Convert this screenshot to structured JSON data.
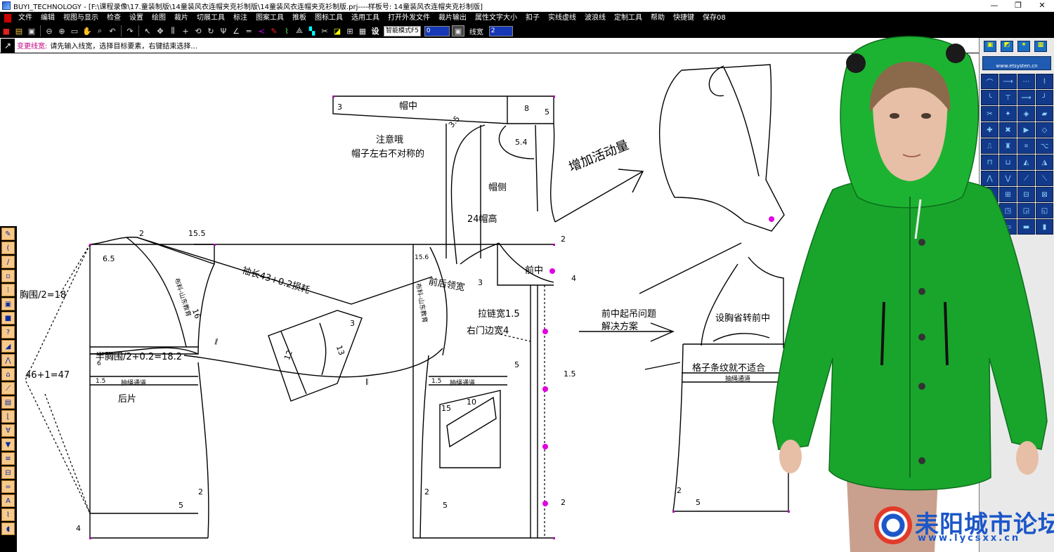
{
  "window": {
    "title": "BUYI_TECHNOLOGY - [F:\\课程录像\\17.童装制版\\14童装风衣连帽夹克衫制版\\14童装风衣连帽夹克衫制版.prj----样板号: 14童装风衣连帽夹克衫制版]",
    "controls": [
      "—",
      "❐",
      "✕"
    ]
  },
  "menu": [
    "文件",
    "编辑",
    "视图与显示",
    "检查",
    "设置",
    "绘图",
    "裁片",
    "切展工具",
    "标注",
    "图案工具",
    "推板",
    "图标工具",
    "选用工具",
    "打开外发文件",
    "裁片输出",
    "属性文字大小",
    "扣子",
    "实线虚线",
    "波浪线",
    "定制工具",
    "帮助",
    "快捷键",
    "保存08"
  ],
  "toolbar": {
    "mode_select": "智能模式F5",
    "value_input": "0",
    "linewidth_label": "线宽",
    "linewidth_input": "2",
    "set_label": "设"
  },
  "status": {
    "command": "变更线宽:",
    "prompt": "请先输入线宽，选择目标要素，右键结束选择..."
  },
  "right_panel": {
    "banner": "www.etsysten.cn"
  },
  "annotations": {
    "hood_center": "帽中",
    "hood_side": "帽侧",
    "hood_height": "24帽高",
    "note1": "注意哦",
    "note2": "帽子左右不对称的",
    "add_ease": "增加活动量",
    "sleeve_len": "袖长43+0.2损耗",
    "collar": "前后领宽",
    "zip_width": "拉链宽1.5",
    "right_door": "右门边宽4",
    "front_center": "前中",
    "solution1": "前中起吊问题",
    "solution2": "解决方案",
    "dart_note": "设胸省转前中",
    "plaid_note": "格子条纹就不适合",
    "back_piece": "后片",
    "half_bust": "半胸围/2+0.2=18.2",
    "bust_left": "胸围/2=18",
    "formula": "46+1=47",
    "drawcord1": "抽绳通道",
    "drawcord2": "抽绳通道",
    "drawcord3": "抽绳通道",
    "n2a": "2",
    "n155": "15.5",
    "n65": "6.5",
    "n16": "16",
    "n3a": "3",
    "n8": "8",
    "n5a": "5",
    "n35": "3.5",
    "n54": "5.4",
    "n2b": "2",
    "n4a": "4",
    "n15a": "1.5",
    "n15b": "1.5",
    "n15c": "1.5",
    "n10": "10",
    "n5b": "5",
    "n5c": "5",
    "n5d": "5",
    "n5e": "5",
    "n2c": "2",
    "n2d": "2",
    "n2e": "2",
    "n4b": "4",
    "n12": "12",
    "n13": "13",
    "n3b": "3",
    "n15d": "15",
    "n6": "6",
    "n3c": "3",
    "n156": "15.6",
    "n2f": "2",
    "sleeve_label1": "布料-山东教育",
    "sleeve_label2": "布料-山东教育"
  },
  "watermark": {
    "name": "耒阳城市论坛",
    "url": "www.lycsxx.cn"
  }
}
